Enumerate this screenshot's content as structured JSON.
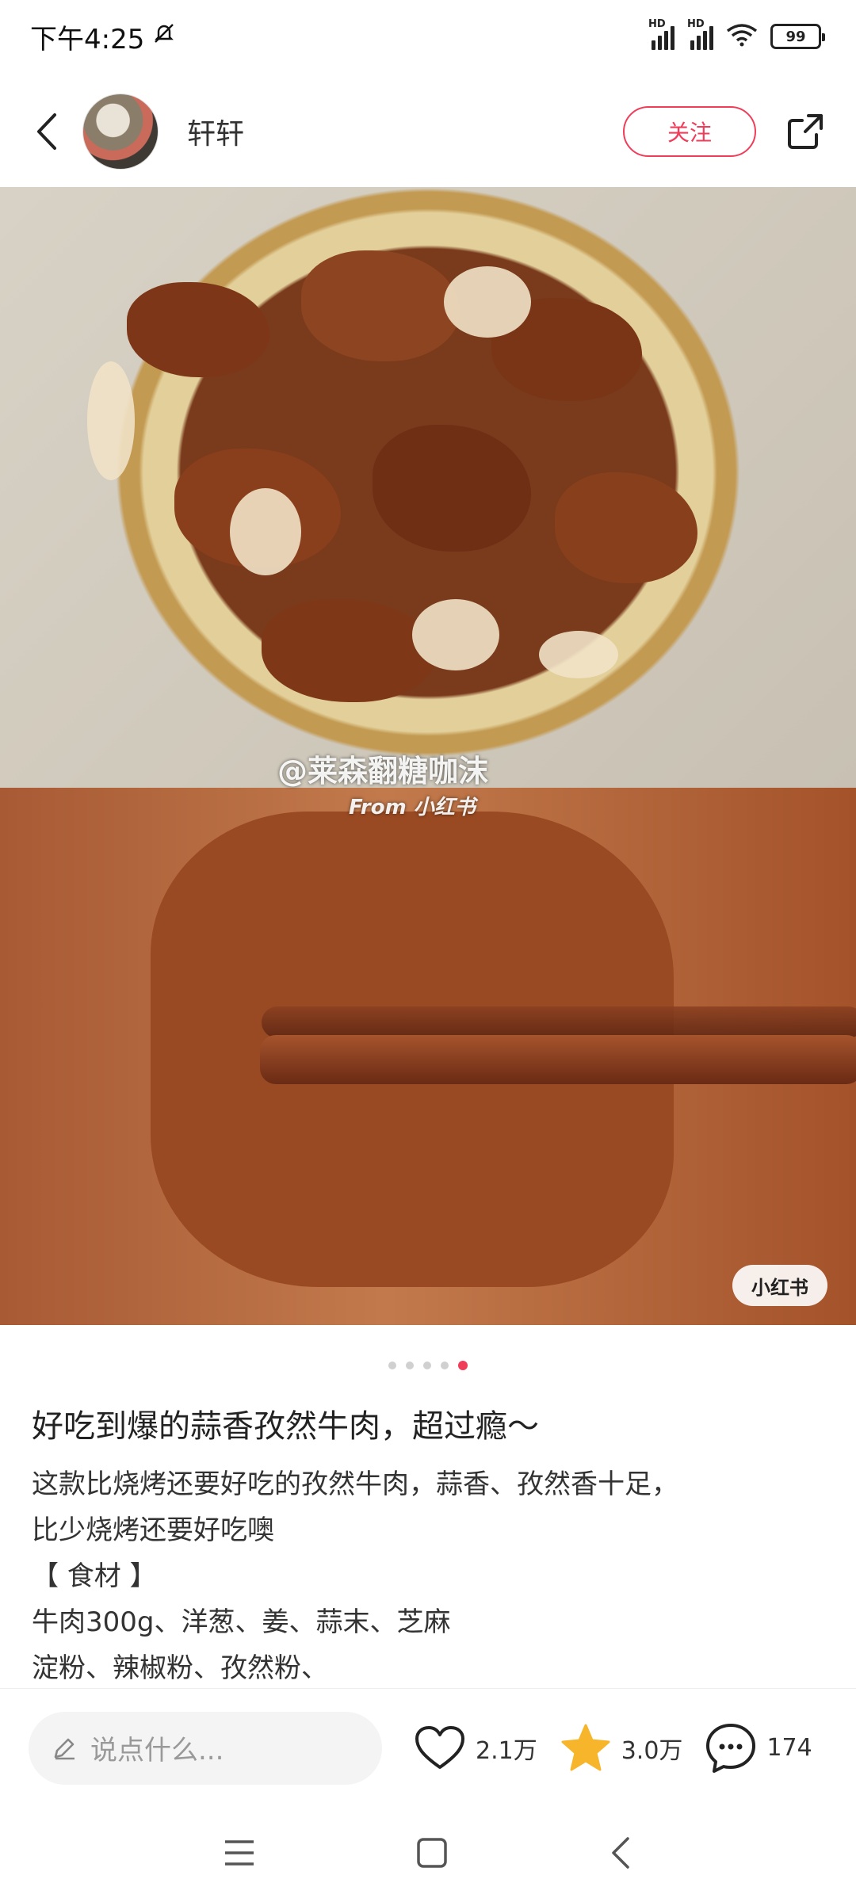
{
  "status": {
    "time": "下午4:25",
    "battery": "99",
    "net1": "HD",
    "net2": "HD"
  },
  "header": {
    "username": "轩轩",
    "follow_label": "关注"
  },
  "photo": {
    "watermark": "@莱森翻糖咖沫",
    "watermark_sub": "From 小红书",
    "logo": "小红书",
    "page_count": 5,
    "current_page": 5
  },
  "post": {
    "title": "好吃到爆的蒜香孜然牛肉，超过瘾～",
    "lines": [
      "这款比烧烤还要好吃的孜然牛肉，蒜香、孜然香十足，",
      "比少烧烤还要好吃噢",
      "【 食材 】",
      "牛肉300g、洋葱、姜、蒜末、芝麻",
      "淀粉、辣椒粉、孜然粉、"
    ]
  },
  "bottom": {
    "comment_placeholder": "说点什么...",
    "likes": "2.1万",
    "favorites": "3.0万",
    "comments": "174"
  },
  "colors": {
    "accent": "#ef3d5a",
    "star": "#f7b52b"
  }
}
